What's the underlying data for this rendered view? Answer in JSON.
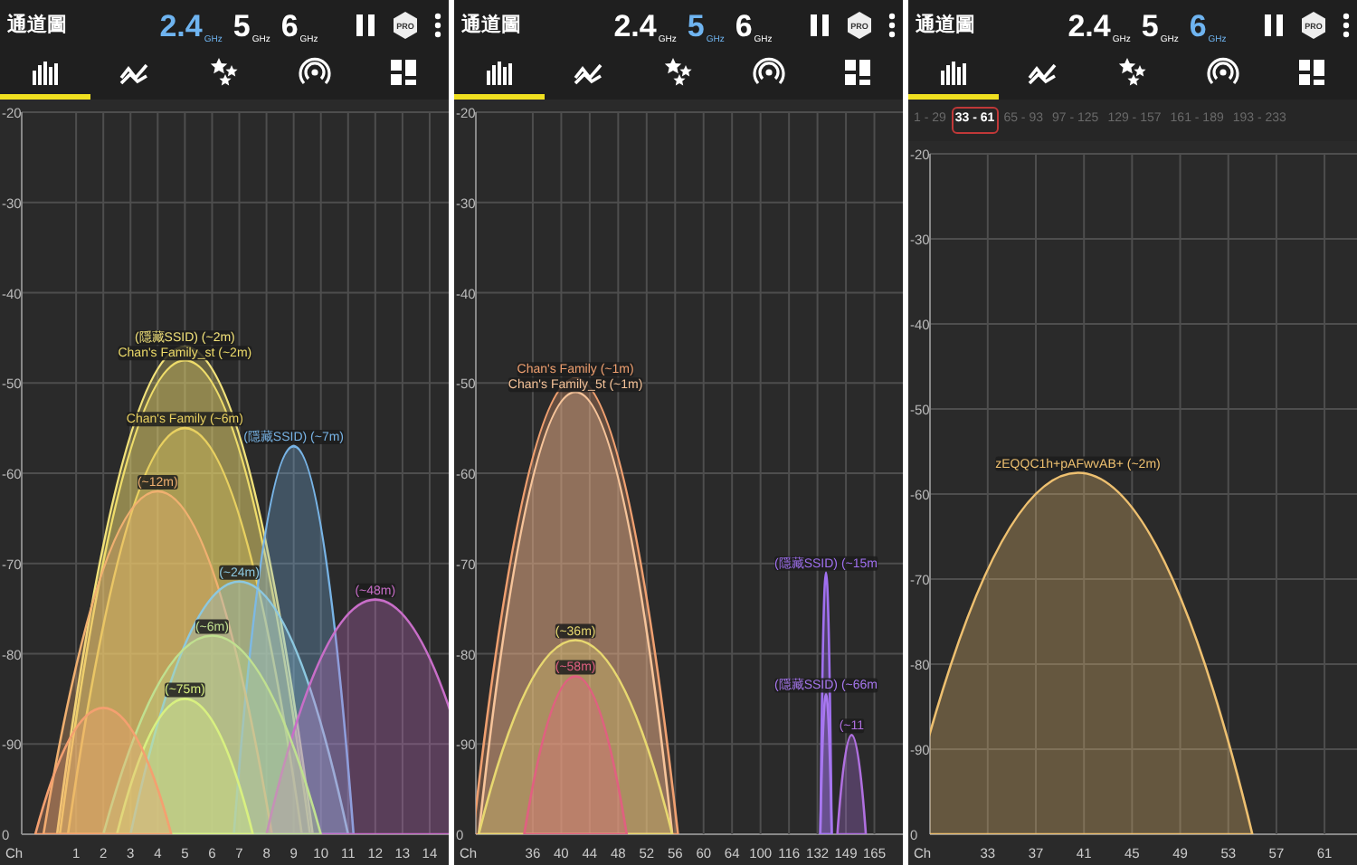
{
  "screens": [
    {
      "title": "通道圖",
      "bands": [
        {
          "label": "2.4",
          "unit": "GHz",
          "selected": true
        },
        {
          "label": "5",
          "unit": "GHz",
          "selected": false
        },
        {
          "label": "6",
          "unit": "GHz",
          "selected": false
        }
      ],
      "badge": "PRO",
      "tabs": [
        {
          "kind": "bars",
          "selected": true
        },
        {
          "kind": "graph",
          "selected": false
        },
        {
          "kind": "stars",
          "selected": false
        },
        {
          "kind": "signal",
          "selected": false
        },
        {
          "kind": "grid",
          "selected": false
        }
      ],
      "spectrum": {
        "y_axis_labels": [
          "-20",
          "-30",
          "-40",
          "-50",
          "-60",
          "-70",
          "-80",
          "-90",
          "0"
        ],
        "x_axis_title": "Ch",
        "x_axis_labels": [
          "1",
          "2",
          "3",
          "4",
          "5",
          "6",
          "7",
          "8",
          "9",
          "10",
          "11",
          "12",
          "13",
          "14"
        ],
        "network_labels": [
          "(隱藏SSID)  (~2m)",
          "Chan's Family_st (~2m)",
          "Chan's Family (~6m)",
          "(隱藏SSID)  (~7m)",
          "(~12m)",
          "(~24m)",
          "(~48m)",
          "(~6m)",
          "(~75m)"
        ]
      }
    },
    {
      "title": "通道圖",
      "bands": [
        {
          "label": "2.4",
          "unit": "GHz",
          "selected": false
        },
        {
          "label": "5",
          "unit": "GHz",
          "selected": true
        },
        {
          "label": "6",
          "unit": "GHz",
          "selected": false
        }
      ],
      "badge": "PRO",
      "tabs": [
        {
          "kind": "bars",
          "selected": true
        },
        {
          "kind": "graph",
          "selected": false
        },
        {
          "kind": "stars",
          "selected": false
        },
        {
          "kind": "signal",
          "selected": false
        },
        {
          "kind": "grid",
          "selected": false
        }
      ],
      "spectrum": {
        "y_axis_labels": [
          "-20",
          "-30",
          "-40",
          "-50",
          "-60",
          "-70",
          "-80",
          "-90",
          "0"
        ],
        "x_axis_title": "Ch",
        "x_axis_labels": [
          "36",
          "40",
          "44",
          "48",
          "52",
          "56",
          "60",
          "64",
          "100",
          "116",
          "132",
          "149",
          "165"
        ],
        "network_labels": [
          "Chan's Family (~1m)",
          "Chan's Family_5t (~1m)",
          "(隱藏SSID)  (~15m",
          "(~36m)",
          "(~58m)",
          "(隱藏SSID)  (~66m",
          "(~11"
        ]
      }
    },
    {
      "title": "通道圖",
      "bands": [
        {
          "label": "2.4",
          "unit": "GHz",
          "selected": false
        },
        {
          "label": "5",
          "unit": "GHz",
          "selected": false
        },
        {
          "label": "6",
          "unit": "GHz",
          "selected": true
        }
      ],
      "badge": "PRO",
      "tabs": [
        {
          "kind": "bars",
          "selected": true
        },
        {
          "kind": "graph",
          "selected": false
        },
        {
          "kind": "stars",
          "selected": false
        },
        {
          "kind": "signal",
          "selected": false
        },
        {
          "kind": "grid",
          "selected": false
        }
      ],
      "channel_ranges": [
        {
          "label": "1 - 29",
          "selected": false
        },
        {
          "label": "33 - 61",
          "selected": true
        },
        {
          "label": "65 - 93",
          "selected": false
        },
        {
          "label": "97 - 125",
          "selected": false
        },
        {
          "label": "129 - 157",
          "selected": false
        },
        {
          "label": "161 - 189",
          "selected": false
        },
        {
          "label": "193 - 233",
          "selected": false
        }
      ],
      "spectrum": {
        "y_axis_labels": [
          "-20",
          "-30",
          "-40",
          "-50",
          "-60",
          "-70",
          "-80",
          "-90",
          "0"
        ],
        "x_axis_title": "Ch",
        "x_axis_labels": [
          "33",
          "37",
          "41",
          "45",
          "49",
          "53",
          "57",
          "61"
        ],
        "network_labels": [
          "zEQQC1h+pAFwvAB+ (~2m)"
        ]
      }
    }
  ]
}
